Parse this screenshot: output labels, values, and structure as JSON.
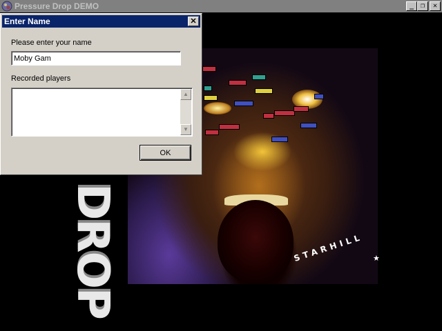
{
  "main_window": {
    "title": "Pressure Drop DEMO",
    "minimize_glyph": "_",
    "restore_glyph": "❐",
    "close_glyph": "✕",
    "app_icon": "game-app-icon"
  },
  "dialog": {
    "title": "Enter Name",
    "close_glyph": "✕",
    "name_prompt": "Please enter your name",
    "name_value": "Moby Gam",
    "recorded_label": "Recorded players",
    "recorded_players": [],
    "ok_label": "OK",
    "scroll_up_glyph": "▲",
    "scroll_down_glyph": "▼"
  },
  "artwork": {
    "vertical_title": "E DROP",
    "publisher": "STARHILL",
    "star_glyph": "★"
  },
  "colors": {
    "dialog_title_bg": "#0a246a",
    "dialog_bg": "#d4d0c8",
    "inactive_title_bg": "#808080",
    "desktop_bg": "#000000"
  }
}
